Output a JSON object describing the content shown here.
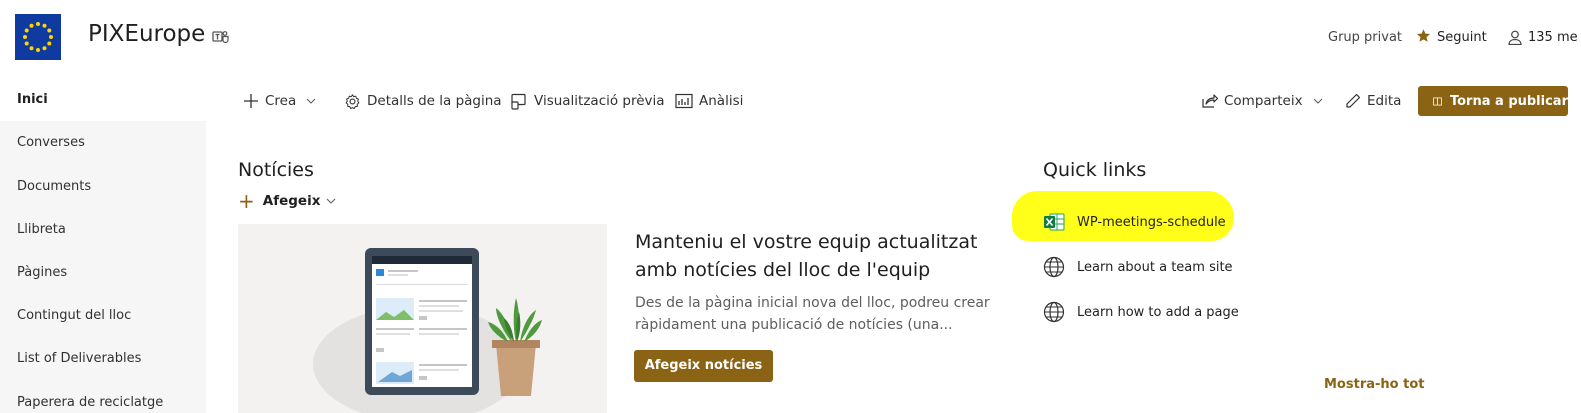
{
  "site": {
    "title": "PIXEurope",
    "privacy": "Grup privat",
    "follow_label": "Seguint",
    "members_label": "135 me"
  },
  "sidebar": {
    "items": [
      {
        "label": "Inici",
        "active": true
      },
      {
        "label": "Converses"
      },
      {
        "label": "Documents"
      },
      {
        "label": "Llibreta"
      },
      {
        "label": "Pàgines"
      },
      {
        "label": "Contingut del lloc"
      },
      {
        "label": "List of Deliverables"
      },
      {
        "label": "Paperera de reciclatge"
      }
    ]
  },
  "toolbar": {
    "new_label": "Crea",
    "page_details_label": "Detalls de la pàgina",
    "preview_label": "Visualització prèvia",
    "analytics_label": "Anàlisi",
    "share_label": "Comparteix",
    "edit_label": "Edita",
    "republish_label": "Torna a publicar"
  },
  "news": {
    "title": "Notícies",
    "add_label": "Afegeix",
    "headline": "Manteniu el vostre equip actualitzat amb notícies del lloc de l'equip",
    "description": "Des de la pàgina inicial nova del lloc, podreu crear ràpidament una publicació de notícies (una...",
    "add_news_button": "Afegeix notícies"
  },
  "quick_links": {
    "title": "Quick links",
    "items": [
      {
        "label": "WP-meetings-schedule",
        "icon": "excel-icon",
        "highlighted": true
      },
      {
        "label": "Learn about a team site",
        "icon": "globe-icon"
      },
      {
        "label": "Learn how to add a page",
        "icon": "globe-icon"
      }
    ],
    "show_all_label": "Mostra-ho tot"
  },
  "colors": {
    "accent": "#8a6314",
    "highlight": "#ffff1a",
    "sidebar_bg": "#f6f6f6",
    "logo_bg": "#0f3ba0"
  }
}
